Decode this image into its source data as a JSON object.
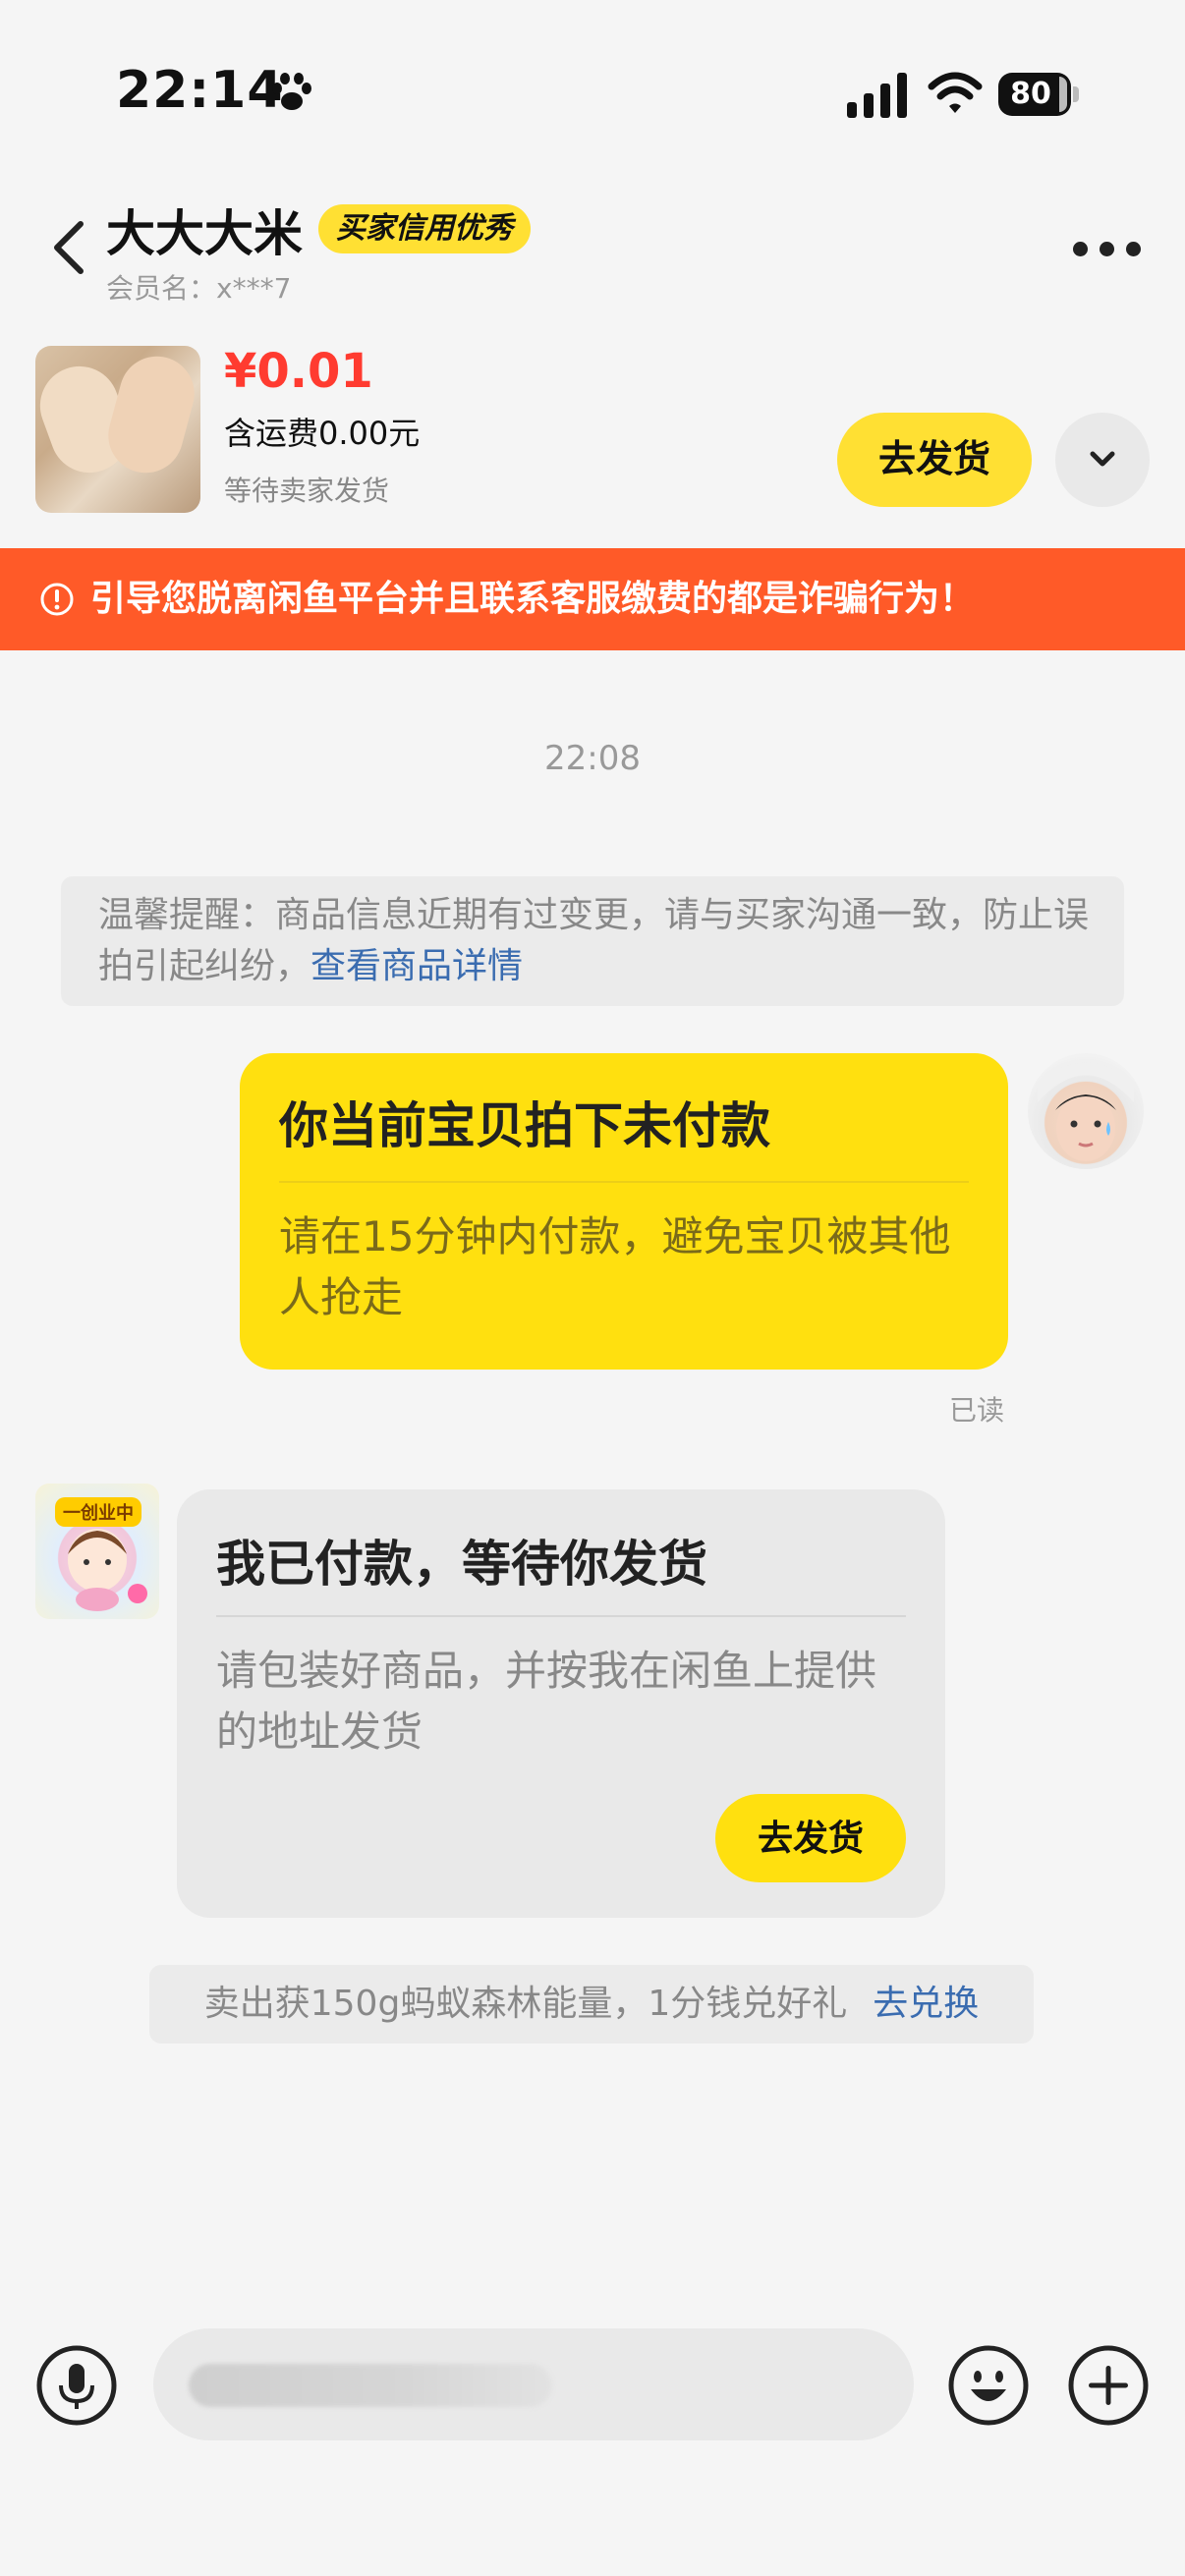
{
  "status_bar": {
    "time": "22:14",
    "battery": "80"
  },
  "header": {
    "name": "大大大米",
    "badge": "买家信用优秀",
    "member": "会员名：x***7"
  },
  "product": {
    "price": "¥0.01",
    "shipping": "含运费0.00元",
    "status": "等待卖家发货",
    "action": "去发货"
  },
  "warning": "引导您脱离闲鱼平台并且联系客服缴费的都是诈骗行为！",
  "chat": {
    "time": "22:08",
    "notice": {
      "text": "温馨提醒：商品信息近期有过变更，请与买家沟通一致，防止误拍引起纠纷，",
      "link": "查看商品详情"
    },
    "msg_right": {
      "title": "你当前宝贝拍下未付款",
      "body": "请在15分钟内付款，避免宝贝被其他人抢走",
      "read": "已读"
    },
    "msg_left": {
      "avatar_tag": "一创业中",
      "title": "我已付款，等待你发货",
      "body": "请包装好商品，并按我在闲鱼上提供的地址发货",
      "action": "去发货"
    },
    "promo": {
      "text": "卖出获150g蚂蚁森林能量，1分钱兑好礼",
      "link": "去兑换"
    }
  },
  "input": {
    "placeholder": ""
  },
  "icons": [
    "paw-icon",
    "signal-icon",
    "wifi-icon",
    "battery-icon",
    "back-icon",
    "more-icon",
    "chevron-down-icon",
    "warning-icon",
    "mic-icon",
    "emoji-icon",
    "plus-icon"
  ]
}
